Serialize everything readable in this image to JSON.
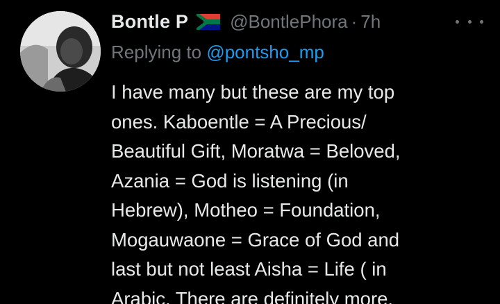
{
  "tweet": {
    "display_name": "Bontle P",
    "flag_icon": "south-africa-flag-icon",
    "handle": "@BontlePhora",
    "separator": "·",
    "time": "7h",
    "more_icon": "more-options-icon",
    "replying_prefix": "Replying to ",
    "replying_to": "@pontsho_mp",
    "body_lines": [
      "I have many but these are my top",
      "ones.  Kaboentle = A Precious/",
      "Beautiful Gift, Moratwa = Beloved,",
      "Azania = God is listening (in",
      "Hebrew), Motheo = Foundation,",
      "Mogauwaone = Grace of God and",
      "last but not least Aisha = Life ( in",
      "Arabic. There are definitely more."
    ]
  },
  "colors": {
    "background": "#000000",
    "text_primary": "#e7e9ea",
    "text_secondary": "#71767b",
    "link": "#1d9bf0"
  }
}
